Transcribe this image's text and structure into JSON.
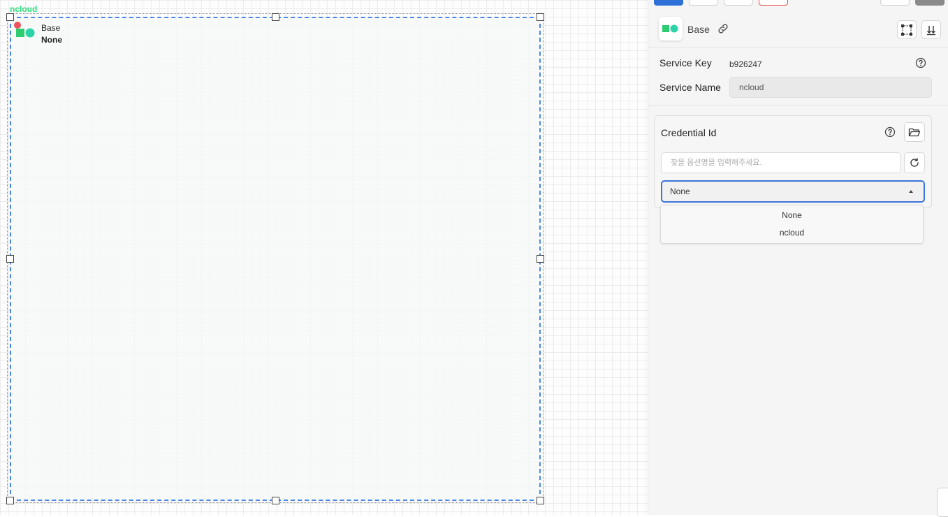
{
  "canvas": {
    "label": "ncloud",
    "node": {
      "type_label": "Base",
      "value_label": "None",
      "icon": "ncloud-logo-icon"
    }
  },
  "panel": {
    "header": {
      "title": "Base",
      "icons": [
        "ncloud-logo-icon",
        "link-icon",
        "node-frame-icon",
        "sort-arrows-icon"
      ]
    },
    "service_key": {
      "label": "Service Key",
      "value": "b926247"
    },
    "service_name": {
      "label": "Service Name",
      "value": "ncloud"
    },
    "credential": {
      "title": "Credential Id",
      "search_placeholder": "찾을 옵션명을 입력해주세요.",
      "selected": "None",
      "options": [
        "None",
        "ncloud"
      ]
    }
  },
  "colors": {
    "accent_blue": "#3b74d9",
    "canvas_label_green": "#2ee07d",
    "logo_green": "#2ecc71",
    "logo_teal": "#2bd3a6",
    "logo_red": "#f0525c",
    "danger_outline": "#e05252"
  }
}
